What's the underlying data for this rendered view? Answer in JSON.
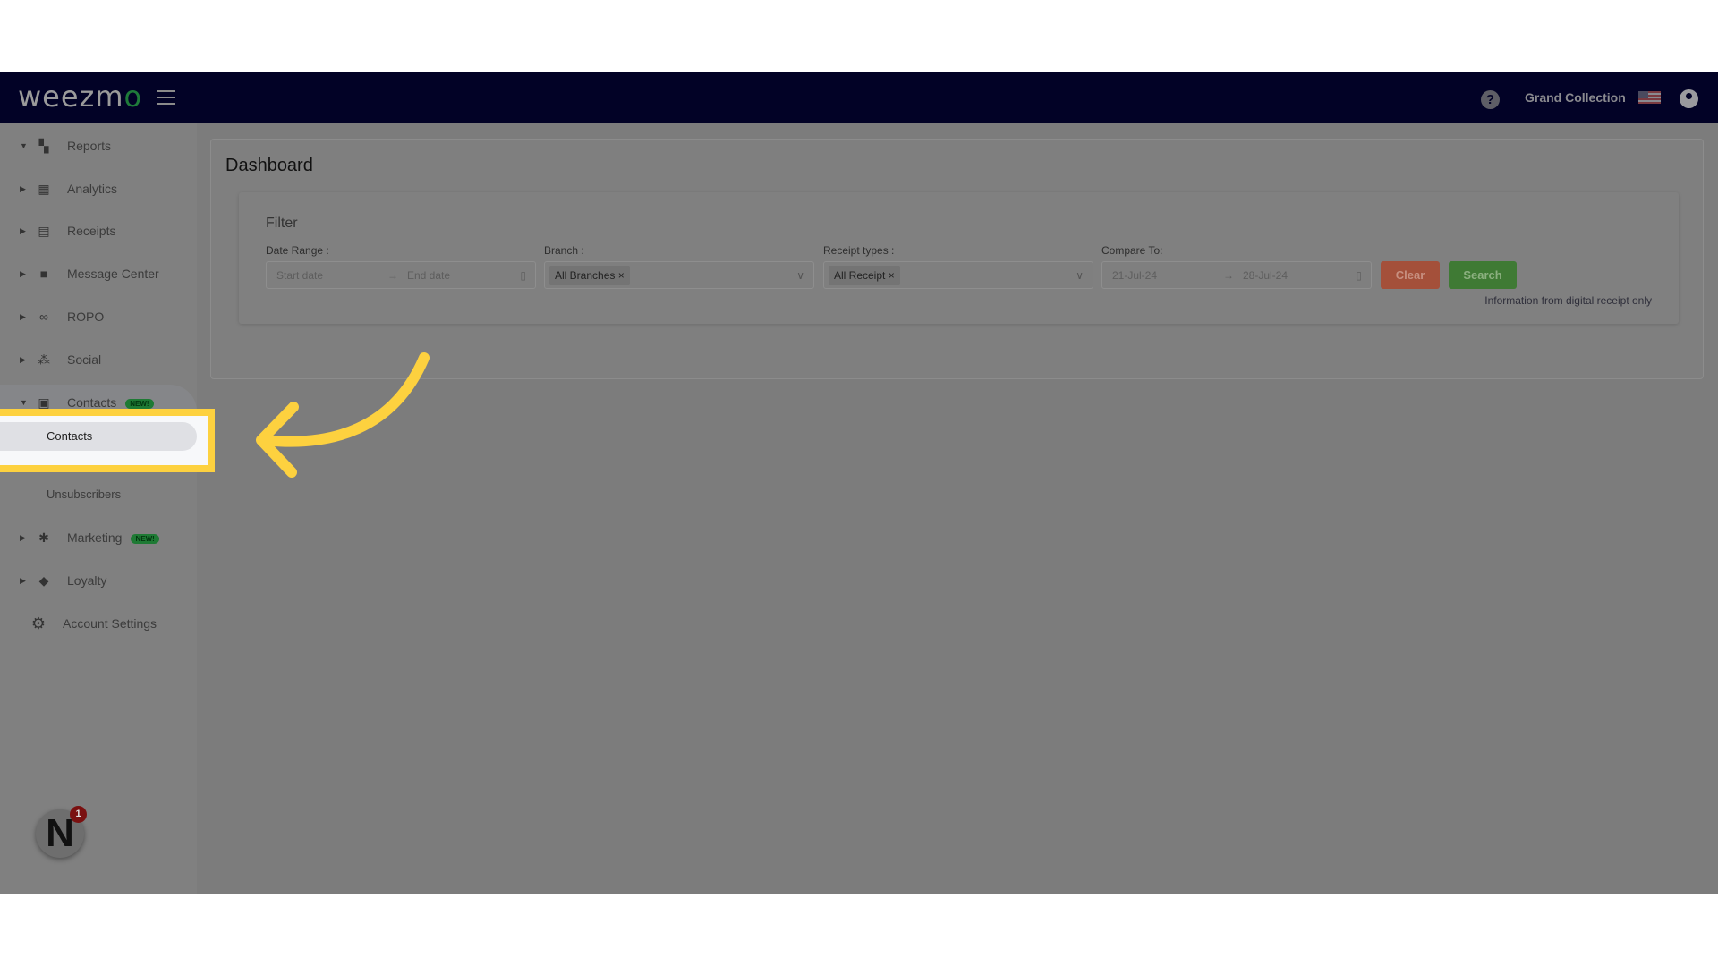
{
  "header": {
    "logo": "weezmo",
    "account_name": "Grand Collection",
    "icons": [
      "menu-icon",
      "help-icon",
      "us-flag-icon",
      "user-icon"
    ]
  },
  "sidebar": {
    "items": [
      {
        "label": "Reports",
        "icon": "dashboard-icon",
        "expanded": true
      },
      {
        "label": "Analytics",
        "icon": "bar-chart-icon"
      },
      {
        "label": "Receipts",
        "icon": "receipt-icon"
      },
      {
        "label": "Message Center",
        "icon": "chat-icon"
      },
      {
        "label": "ROPO",
        "icon": "infinity-icon"
      },
      {
        "label": "Social",
        "icon": "people-icon"
      },
      {
        "label": "Contacts",
        "icon": "contact-icon",
        "badge": "NEW!",
        "expanded": true
      },
      {
        "label": "Marketing",
        "icon": "party-popper-icon",
        "badge": "NEW!"
      },
      {
        "label": "Loyalty",
        "icon": "tag-icon"
      },
      {
        "label": "Account Settings",
        "icon": "gear-icon"
      }
    ],
    "contacts_sub": [
      "Contacts",
      "Unsubscribers"
    ],
    "notification_count": "1"
  },
  "main": {
    "title": "Dashboard",
    "filter": {
      "title": "Filter",
      "date_range": {
        "label": "Date Range :",
        "start_placeholder": "Start date",
        "end_placeholder": "End date"
      },
      "branch": {
        "label": "Branch :",
        "value": "All Branches"
      },
      "receipt_types": {
        "label": "Receipt types :",
        "value": "All Receipt"
      },
      "compare_to": {
        "label": "Compare To:",
        "start": "21-Jul-24",
        "end": "28-Jul-24"
      },
      "clear_label": "Clear",
      "search_label": "Search",
      "info": "Information from digital receipt only"
    }
  },
  "colors": {
    "header": "#020226",
    "highlight": "#fdd13f",
    "clear": "#a4503a",
    "search": "#3f7a34",
    "badge": "#1e7a34"
  }
}
